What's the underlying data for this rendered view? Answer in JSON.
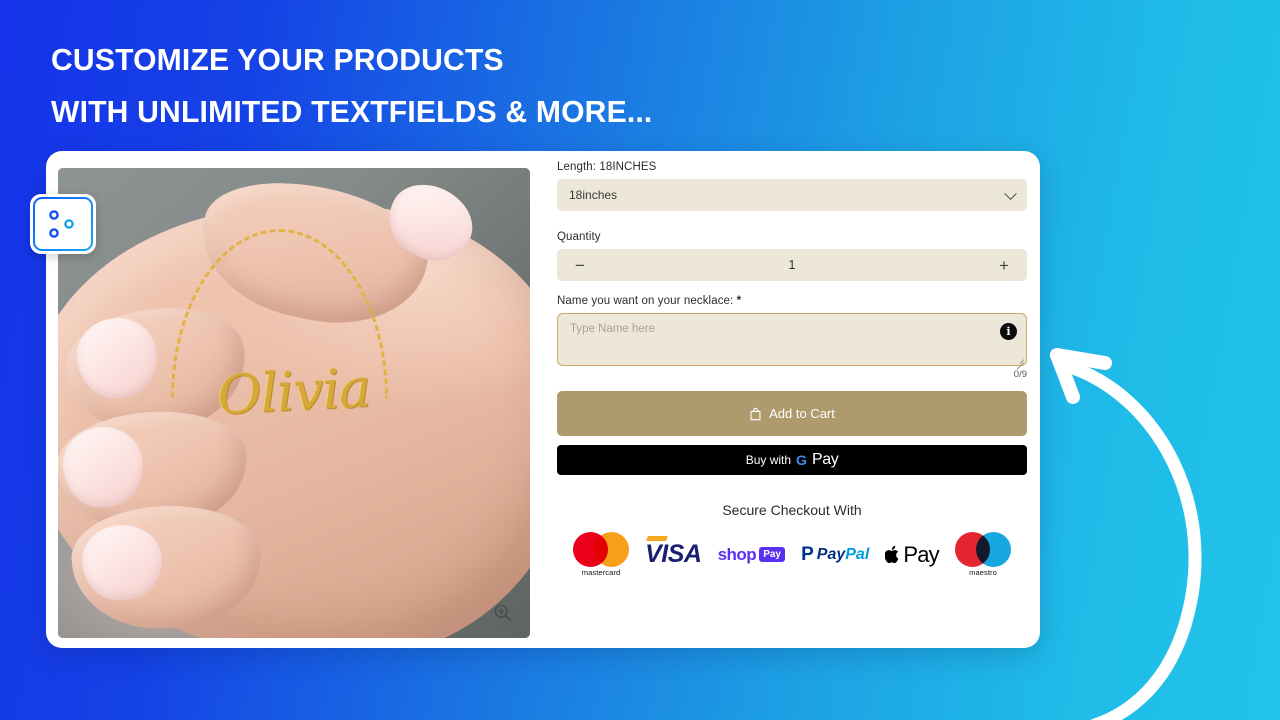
{
  "headline": {
    "line1": "CUSTOMIZE YOUR PRODUCTS",
    "line2": "WITH UNLIMITED TEXTFIELDS & MORE..."
  },
  "colors": {
    "bg_left": "#1533E9",
    "bg_right": "#20C4EA",
    "field_bg": "#EDE7DA",
    "add_to_cart": "#AE9A6C",
    "textarea_border": "#C9A860",
    "gpay_bg": "#000000"
  },
  "badge": {
    "icon": "sliders-icon"
  },
  "product": {
    "alt": "Hand holding gold Olivia name necklace",
    "script_name": "Olivia",
    "zoom_icon": "magnifier-plus-icon"
  },
  "form": {
    "length": {
      "label": "Length: 18INCHES",
      "selected": "18inches",
      "chevron_icon": "chevron-down-icon"
    },
    "quantity": {
      "label": "Quantity",
      "decrement": "−",
      "value": "1",
      "increment": "+"
    },
    "name_field": {
      "label": "Name you want on your necklace:",
      "required_mark": "*",
      "placeholder": "Type Name here",
      "value": "",
      "info_icon": "info-icon",
      "info_glyph": "i",
      "counter": "0/9"
    },
    "add_to_cart": {
      "label": "Add to Cart",
      "icon": "shopping-bag-icon"
    },
    "gpay": {
      "prefix": "Buy with",
      "g": "G",
      "pay": "Pay"
    },
    "secure": {
      "title": "Secure Checkout With",
      "methods": [
        {
          "name": "mastercard",
          "caption": "mastercard"
        },
        {
          "name": "visa",
          "label": "VISA"
        },
        {
          "name": "shop-pay",
          "word": "shop",
          "badge": "Pay"
        },
        {
          "name": "paypal",
          "mark": "P",
          "part_a": "Pay",
          "part_b": "Pal"
        },
        {
          "name": "apple-pay",
          "logo": "",
          "word": "Pay"
        },
        {
          "name": "maestro",
          "caption": "maestro"
        }
      ]
    }
  },
  "annotation": {
    "arrow": "curved-arrow-icon"
  }
}
